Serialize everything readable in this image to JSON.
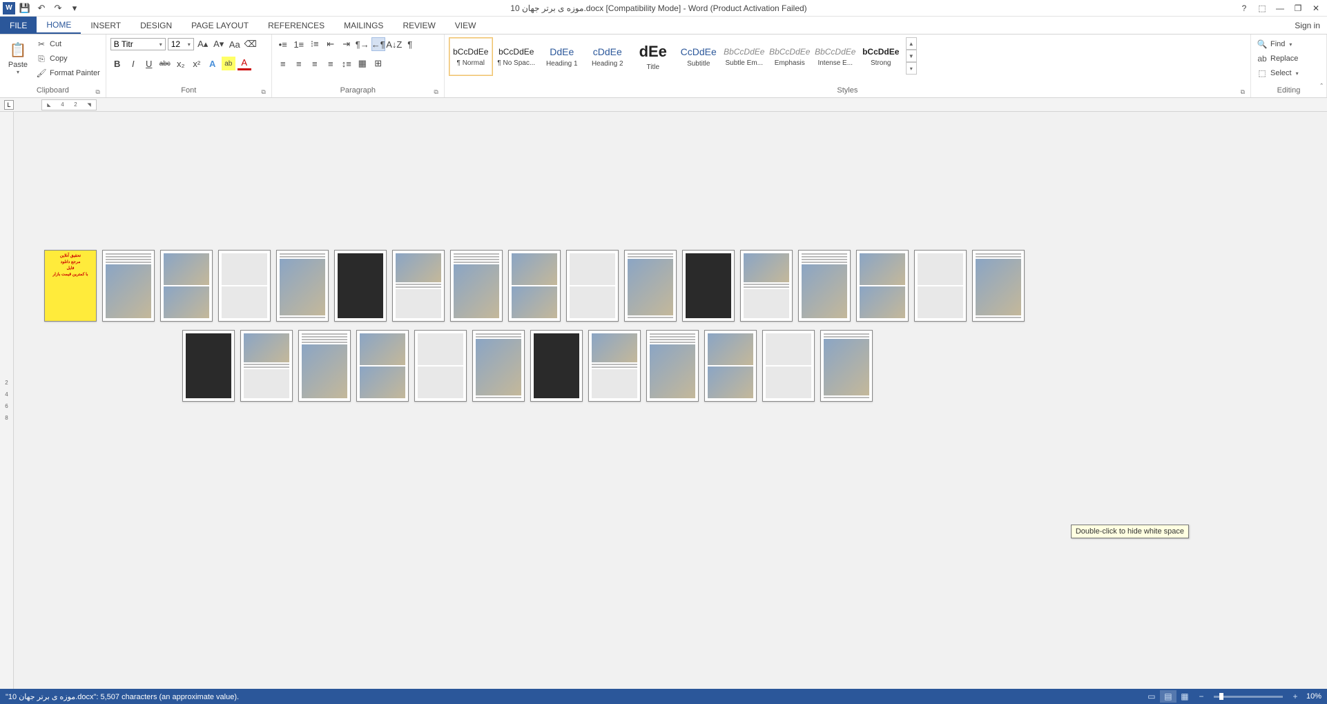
{
  "titlebar": {
    "word_logo": "W",
    "title": "موزه ی برتر جهان 10.docx [Compatibility Mode] - Word (Product Activation Failed)"
  },
  "qat": {
    "save": "💾",
    "undo": "↶",
    "redo": "↷",
    "custom": "▾"
  },
  "win": {
    "help": "?",
    "ribbon_opts": "⬚",
    "min": "—",
    "restore": "❐",
    "close": "✕"
  },
  "tabs": {
    "file": "FILE",
    "home": "HOME",
    "insert": "INSERT",
    "design": "DESIGN",
    "pagelayout": "PAGE LAYOUT",
    "references": "REFERENCES",
    "mailings": "MAILINGS",
    "review": "REVIEW",
    "view": "VIEW",
    "signin": "Sign in"
  },
  "clipboard": {
    "paste": "Paste",
    "cut": "Cut",
    "copy": "Copy",
    "format_painter": "Format Painter",
    "group": "Clipboard"
  },
  "font": {
    "name": "B Titr",
    "size": "12",
    "grow": "A▴",
    "shrink": "A▾",
    "case": "Aa",
    "clear": "⌫",
    "bold": "B",
    "italic": "I",
    "underline": "U",
    "strike": "abc",
    "sub": "x₂",
    "sup": "x²",
    "effects": "A",
    "highlight": "ab",
    "color": "A",
    "group": "Font"
  },
  "paragraph": {
    "bullets": "•≡",
    "numbers": "1≡",
    "multi": "⁝≡",
    "dec_indent": "⇤",
    "inc_indent": "⇥",
    "ltr": "¶→",
    "rtl": "←¶",
    "sort": "A↓Z",
    "marks": "¶",
    "al": "≡",
    "ac": "≡",
    "ar": "≡",
    "aj": "≡",
    "spacing": "↕≡",
    "shading": "▦",
    "borders": "⊞",
    "group": "Paragraph"
  },
  "styles": {
    "items": [
      {
        "preview": "bCcDdEe",
        "name": "¶ Normal",
        "cls": ""
      },
      {
        "preview": "bCcDdEe",
        "name": "¶ No Spac...",
        "cls": ""
      },
      {
        "preview": "DdEe",
        "name": "Heading 1",
        "cls": "style-heading"
      },
      {
        "preview": "cDdEe",
        "name": "Heading 2",
        "cls": "style-heading"
      },
      {
        "preview": "dEe",
        "name": "Title",
        "cls": "style-large"
      },
      {
        "preview": "CcDdEe",
        "name": "Subtitle",
        "cls": "style-heading"
      },
      {
        "preview": "BbCcDdEe",
        "name": "Subtle Em...",
        "cls": "style-em"
      },
      {
        "preview": "BbCcDdEe",
        "name": "Emphasis",
        "cls": "style-em"
      },
      {
        "preview": "BbCcDdEe",
        "name": "Intense E...",
        "cls": "style-em"
      },
      {
        "preview": "bCcDdEe",
        "name": "Strong",
        "cls": "style-strong"
      }
    ],
    "group": "Styles"
  },
  "editing": {
    "find": "Find",
    "replace": "Replace",
    "select": "Select",
    "group": "Editing"
  },
  "ruler": {
    "n1": "4",
    "n2": "2"
  },
  "side_ruler": [
    "2",
    "4",
    "6",
    "8"
  ],
  "tooltip": "Double-click to hide white space",
  "statusbar": {
    "text": "\"موزه ی برتر جهان 10.docx\": 5,507 characters (an approximate value).",
    "zoom_minus": "−",
    "zoom_plus": "+",
    "zoom": "10%"
  },
  "thumbs": {
    "row1_count": 17,
    "row2_count": 12,
    "cover_lines": [
      "تحقیق آنلاین",
      "مرجع دانلود",
      "فایل",
      "با کمترین قیمت بازار"
    ]
  }
}
